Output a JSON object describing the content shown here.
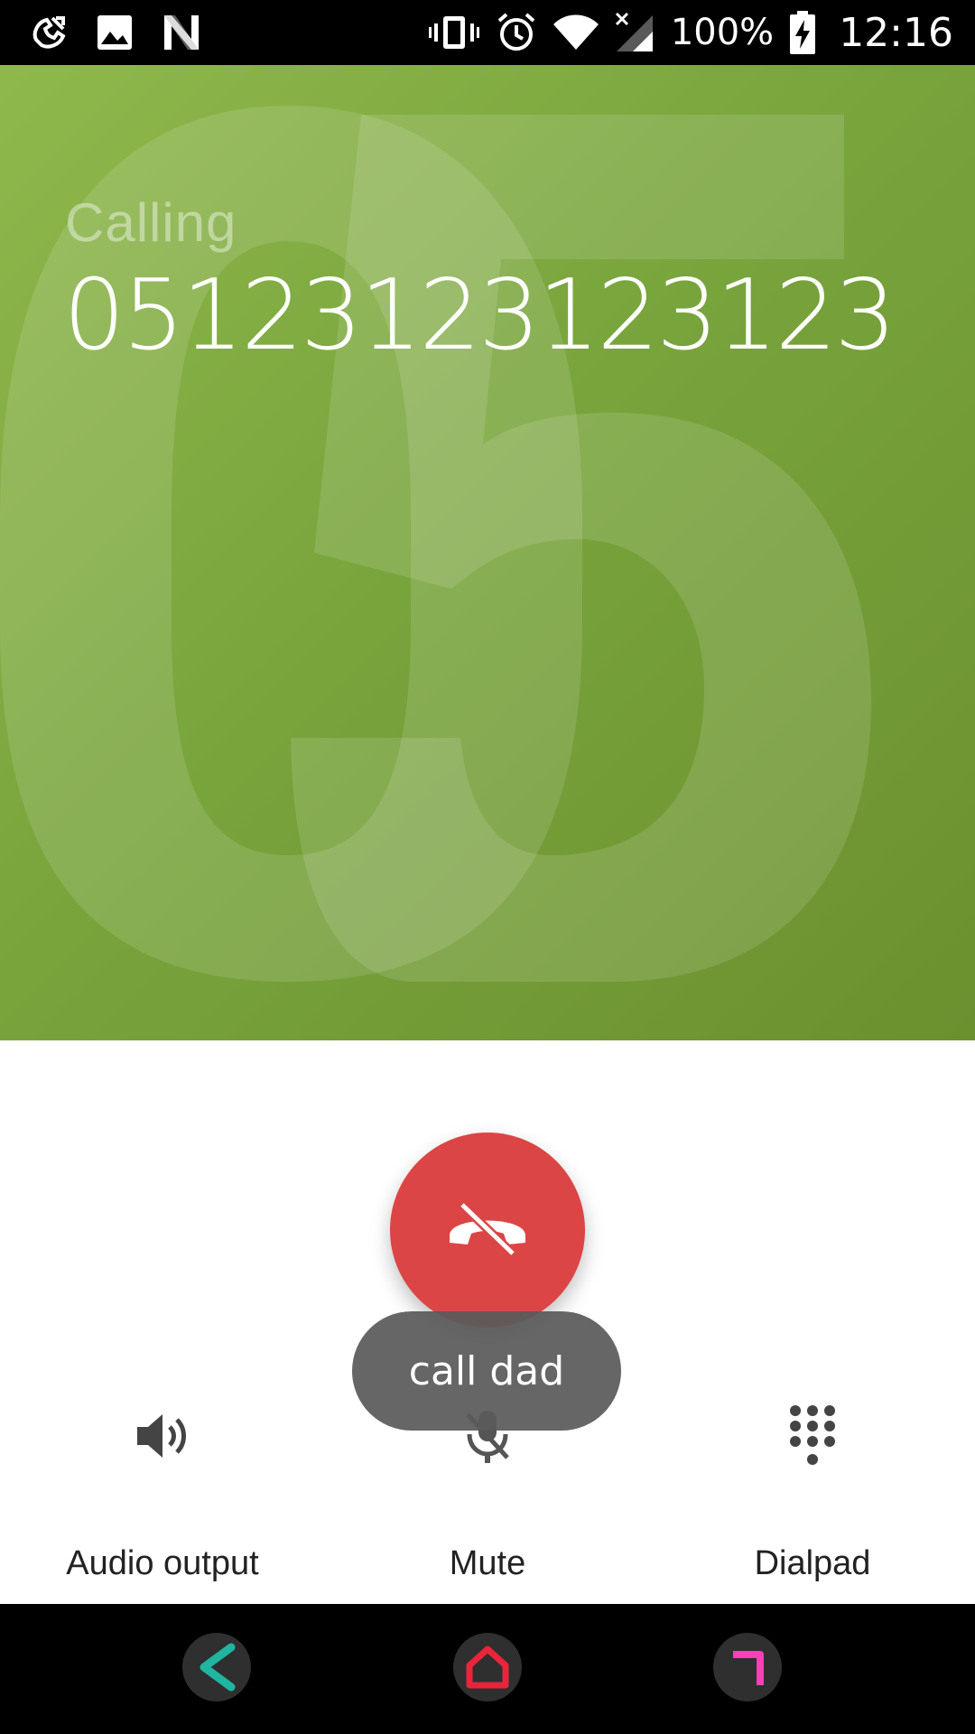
{
  "status_bar": {
    "battery": "100%",
    "time": "12:16",
    "left_icons": [
      "missed-call-icon",
      "image-icon",
      "n-logo-icon"
    ],
    "right_icons": [
      "vibrate-icon",
      "alarm-icon",
      "wifi-icon",
      "signal-icon",
      "battery-charging-icon"
    ]
  },
  "call": {
    "status": "Calling",
    "number": "05123123123123",
    "background_digits": "05"
  },
  "controls": {
    "end_call_icon": "end-call-icon",
    "audio_output": "Audio output",
    "mute": "Mute",
    "dialpad": "Dialpad"
  },
  "toast": {
    "text": "call dad"
  },
  "colors": {
    "hero_start": "#8fb84c",
    "hero_end": "#6b902f",
    "end_call": "#dc4545",
    "nav_back": "#1fb5a0",
    "nav_home": "#e8253a",
    "nav_recents": "#ff3fb4"
  },
  "nav_bar": {
    "icons": [
      "back-icon",
      "home-icon",
      "recents-icon"
    ]
  }
}
